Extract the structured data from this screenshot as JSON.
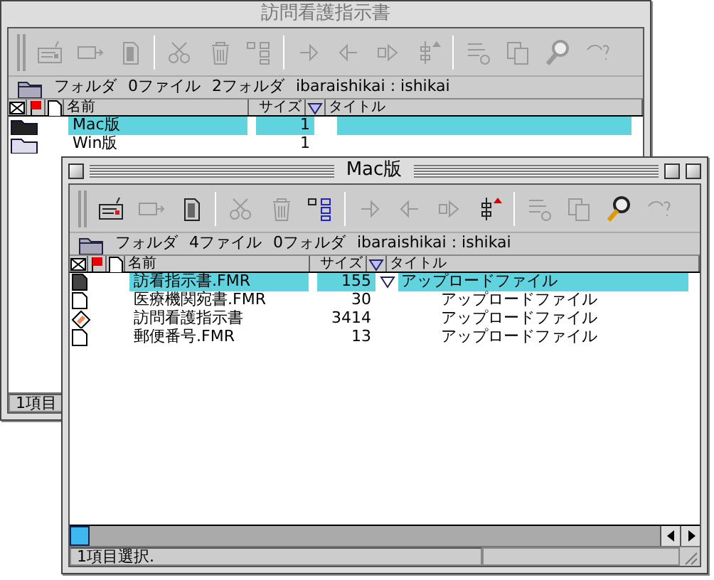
{
  "windows": [
    {
      "title": "訪問看護指示書",
      "active": false,
      "toolbar": [
        {
          "kind": "compose",
          "disabled": true
        },
        {
          "kind": "send",
          "disabled": true
        },
        {
          "kind": "document",
          "disabled": true
        },
        {
          "kind": "cut",
          "disabled": true
        },
        {
          "kind": "trash",
          "disabled": true
        },
        {
          "kind": "list",
          "disabled": true
        },
        {
          "kind": "forward",
          "disabled": true
        },
        {
          "kind": "back",
          "disabled": true
        },
        {
          "kind": "next",
          "disabled": true
        },
        {
          "kind": "sort",
          "disabled": true
        },
        {
          "kind": "settings",
          "disabled": true
        },
        {
          "kind": "copy",
          "disabled": true
        },
        {
          "kind": "search",
          "disabled": true
        },
        {
          "kind": "help",
          "disabled": true
        }
      ],
      "path": {
        "folder": "フォルダ",
        "files": "0ファイル",
        "folders": "2フォルダ",
        "location": "ibaraishikai : ishikai"
      },
      "columns": {
        "name": "名前",
        "size": "サイズ",
        "title": "タイトル"
      },
      "rows": [
        {
          "kind": "folder",
          "name": "Mac版",
          "size": "1",
          "selected": true,
          "marked": false
        },
        {
          "kind": "folder",
          "name": "Win版",
          "size": "1",
          "selected": false,
          "marked": false
        }
      ],
      "status": "1項目"
    },
    {
      "title": "Mac版",
      "active": true,
      "toolbar": [
        {
          "kind": "compose",
          "disabled": false
        },
        {
          "kind": "send",
          "disabled": true
        },
        {
          "kind": "document",
          "disabled": false
        },
        {
          "kind": "cut",
          "disabled": true
        },
        {
          "kind": "trash",
          "disabled": true
        },
        {
          "kind": "list",
          "disabled": false
        },
        {
          "kind": "forward",
          "disabled": true
        },
        {
          "kind": "back",
          "disabled": true
        },
        {
          "kind": "next",
          "disabled": true
        },
        {
          "kind": "sort",
          "disabled": false
        },
        {
          "kind": "settings",
          "disabled": true
        },
        {
          "kind": "copy",
          "disabled": true
        },
        {
          "kind": "search",
          "disabled": false
        },
        {
          "kind": "help",
          "disabled": true
        }
      ],
      "path": {
        "folder": "フォルダ",
        "files": "4ファイル",
        "folders": "0フォルダ",
        "location": "ibaraishikai : ishikai"
      },
      "columns": {
        "name": "名前",
        "size": "サイズ",
        "title": "タイトル"
      },
      "rows": [
        {
          "kind": "document",
          "name": "訪看指示書.FMR",
          "size": "155",
          "title": "アップロードファイル",
          "selected": true,
          "marked": true
        },
        {
          "kind": "document",
          "name": "医療機関宛書.FMR",
          "size": "30",
          "title": "アップロードファイル",
          "selected": false,
          "marked": false
        },
        {
          "kind": "application",
          "name": "訪問看護指示書",
          "size": "3414",
          "title": "アップロードファイル",
          "selected": false,
          "marked": false
        },
        {
          "kind": "document",
          "name": "郵便番号.FMR",
          "size": "13",
          "title": "アップロードファイル",
          "selected": false,
          "marked": false
        }
      ],
      "status": "1項目選択."
    }
  ]
}
